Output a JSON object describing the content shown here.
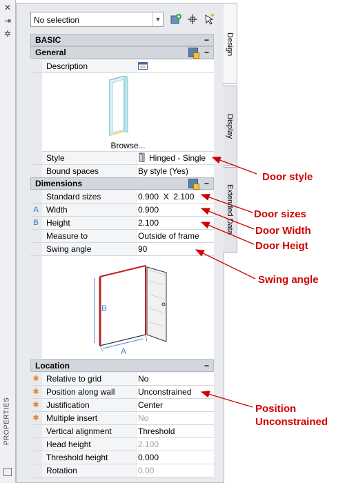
{
  "strip": {
    "close_glyph": "✕",
    "autohide_glyph": "⇥",
    "settings_glyph": "✲",
    "title": "PROPERTIES"
  },
  "selector": {
    "value": "No selection"
  },
  "sections": {
    "basic": "BASIC",
    "general": "General",
    "dimensions": "Dimensions",
    "location": "Location",
    "collapse_glyph": "−"
  },
  "general": {
    "description_label": "Description",
    "browse_label": "Browse...",
    "style_label": "Style",
    "style_value": "Hinged - Single",
    "bound_label": "Bound spaces",
    "bound_value": "By style (Yes)"
  },
  "dimensions": {
    "rows": [
      {
        "abbr": "",
        "label": "Standard sizes",
        "value": "0.900  X  2.100"
      },
      {
        "abbr": "A",
        "label": "Width",
        "value": "0.900"
      },
      {
        "abbr": "B",
        "label": "Height",
        "value": "2.100"
      },
      {
        "abbr": "",
        "label": "Measure to",
        "value": "Outside of frame"
      },
      {
        "abbr": "",
        "label": "Swing angle",
        "value": "90"
      }
    ],
    "diagram": {
      "label_a": "A",
      "label_b": "B"
    }
  },
  "location": {
    "rows": [
      {
        "star": "✱",
        "label": "Relative to grid",
        "value": "No",
        "disabled": false
      },
      {
        "star": "✱",
        "label": "Position along wall",
        "value": "Unconstrained",
        "disabled": false
      },
      {
        "star": "✱",
        "label": "Justification",
        "value": "Center",
        "disabled": false
      },
      {
        "star": "✱",
        "label": "Multiple insert",
        "value": "No",
        "disabled": true
      },
      {
        "star": "",
        "label": "Vertical alignment",
        "value": "Threshold",
        "disabled": false
      },
      {
        "star": "",
        "label": "Head height",
        "value": "2.100",
        "disabled": true
      },
      {
        "star": "",
        "label": "Threshold height",
        "value": "0.000",
        "disabled": false
      },
      {
        "star": "",
        "label": "Rotation",
        "value": "0.00",
        "disabled": true
      }
    ]
  },
  "tabs": {
    "design": "Design",
    "display": "Display",
    "extended": "Extended Data"
  },
  "annotations": {
    "door_style": "Door style",
    "door_sizes": "Door sizes",
    "door_width": "Door Width",
    "door_height": "Door Heigt",
    "swing_angle": "Swing angle",
    "position_line1": "Position",
    "position_line2": "Unconstrained"
  },
  "colors": {
    "annotation": "#d10000",
    "accent_blue": "#2f6fd1",
    "star": "#e2872c",
    "door_edge": "#c02020"
  }
}
